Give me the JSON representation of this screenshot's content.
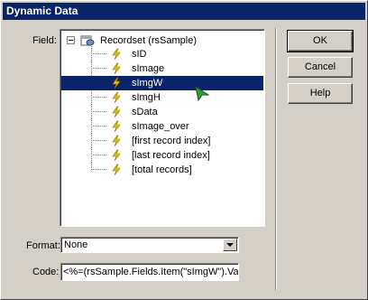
{
  "window": {
    "title": "Dynamic Data"
  },
  "field": {
    "label": "Field:",
    "root": {
      "label": "Recordset (rsSample)",
      "icon": "recordset-icon",
      "expander": "minus"
    },
    "items": [
      {
        "label": "sID",
        "icon": "lightning-bolt-icon",
        "selected": false
      },
      {
        "label": "sImage",
        "icon": "lightning-bolt-icon",
        "selected": false
      },
      {
        "label": "sImgW",
        "icon": "lightning-bolt-icon",
        "selected": true
      },
      {
        "label": "sImgH",
        "icon": "lightning-bolt-icon",
        "selected": false
      },
      {
        "label": "sData",
        "icon": "lightning-bolt-icon",
        "selected": false
      },
      {
        "label": "sImage_over",
        "icon": "lightning-bolt-icon",
        "selected": false
      },
      {
        "label": "[first record index]",
        "icon": "lightning-bolt-icon",
        "selected": false
      },
      {
        "label": "[last record index]",
        "icon": "lightning-bolt-icon",
        "selected": false
      },
      {
        "label": "[total records]",
        "icon": "lightning-bolt-icon",
        "selected": false
      }
    ]
  },
  "format": {
    "label": "Format:",
    "value": "None"
  },
  "code": {
    "label": "Code:",
    "value": "<%=(rsSample.Fields.Item(\"sImgW\").Valu"
  },
  "buttons": {
    "ok": "OK",
    "cancel": "Cancel",
    "help": "Help"
  },
  "colors": {
    "titlebar": "#0a246a",
    "selection": "#0a246a",
    "bolt": "#e8c000",
    "cursor": "#2ea03a"
  }
}
